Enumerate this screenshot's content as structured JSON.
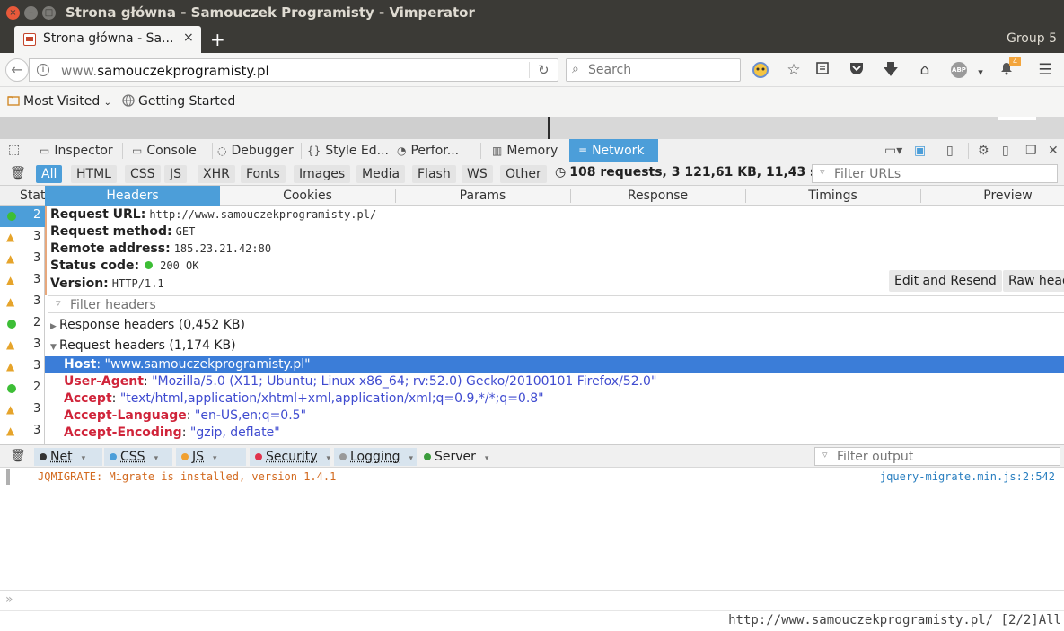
{
  "window": {
    "title": "Strona główna - Samouczek Programisty - Vimperator",
    "close_glyph": "×",
    "min_glyph": "–",
    "max_glyph": "□"
  },
  "tabs": {
    "active_label": "Strona główna - Sa...",
    "close_glyph": "×",
    "new_tab_glyph": "+",
    "group_label": "Group 5"
  },
  "navbar": {
    "url_host_prefix": "www.",
    "url_host_rest": "samouczekprogramisty.pl",
    "search_placeholder": "Search",
    "badge_count": "4",
    "icons": [
      "back-arrow-icon",
      "info-icon",
      "reload-icon",
      "search-icon",
      "screenshot-icon",
      "bookmark-star-icon",
      "reading-list-icon",
      "pocket-icon",
      "download-icon",
      "home-icon",
      "adblock-icon",
      "notifications-icon",
      "menu-icon"
    ]
  },
  "bookmarks": {
    "most_visited": "Most Visited",
    "getting_started": "Getting Started"
  },
  "devtools": {
    "tabs": [
      {
        "label": "Inspector"
      },
      {
        "label": "Console"
      },
      {
        "label": "Debugger"
      },
      {
        "label": "Style Ed..."
      },
      {
        "label": "Perfor..."
      },
      {
        "label": "Memory"
      },
      {
        "label": "Network"
      }
    ],
    "active_tab": "Network"
  },
  "network": {
    "filters": [
      "All",
      "HTML",
      "CSS",
      "JS",
      "XHR",
      "Fonts",
      "Images",
      "Media",
      "Flash",
      "WS",
      "Other"
    ],
    "active_filter": "All",
    "summary": "108 requests, 3 121,61 KB, 11,43 s",
    "filter_urls_placeholder": "Filter URLs",
    "status_column": "Status",
    "rows": [
      {
        "type": "ok",
        "code": "2"
      },
      {
        "type": "warn",
        "code": "3"
      },
      {
        "type": "warn",
        "code": "3"
      },
      {
        "type": "warn",
        "code": "3"
      },
      {
        "type": "warn",
        "code": "3"
      },
      {
        "type": "ok",
        "code": "2"
      },
      {
        "type": "warn",
        "code": "3"
      },
      {
        "type": "warn",
        "code": "3"
      },
      {
        "type": "ok",
        "code": "2"
      },
      {
        "type": "warn",
        "code": "3"
      },
      {
        "type": "warn",
        "code": "3"
      }
    ]
  },
  "details": {
    "tabs": [
      "Headers",
      "Cookies",
      "Params",
      "Response",
      "Timings",
      "Preview"
    ],
    "active_tab": "Headers",
    "request_url_label": "Request URL:",
    "request_url": "http://www.samouczekprogramisty.pl/",
    "method_label": "Request method:",
    "method": "GET",
    "remote_label": "Remote address:",
    "remote": "185.23.21.42:80",
    "status_label": "Status code:",
    "status": "200 OK",
    "version_label": "Version:",
    "version": "HTTP/1.1",
    "edit_resend": "Edit and Resend",
    "raw_headers": "Raw head",
    "filter_headers_placeholder": "Filter headers",
    "response_headers": "Response headers (0,452 KB)",
    "request_headers": "Request headers (1,174 KB)",
    "headers": [
      {
        "key": "Host",
        "value": "\"www.samouczekprogramisty.pl\""
      },
      {
        "key": "User-Agent",
        "value": "\"Mozilla/5.0 (X11; Ubuntu; Linux x86_64; rv:52.0) Gecko/20100101 Firefox/52.0\""
      },
      {
        "key": "Accept",
        "value": "\"text/html,application/xhtml+xml,application/xml;q=0.9,*/*;q=0.8\""
      },
      {
        "key": "Accept-Language",
        "value": "\"en-US,en;q=0.5\""
      },
      {
        "key": "Accept-Encoding",
        "value": "\"gzip, deflate\""
      }
    ]
  },
  "console": {
    "buttons": [
      {
        "label": "Net",
        "color": "#333333"
      },
      {
        "label": "CSS",
        "color": "#4c9ed9"
      },
      {
        "label": "JS",
        "color": "#f0a030"
      },
      {
        "label": "Security",
        "color": "#e0334d"
      },
      {
        "label": "Logging",
        "color": "#999999"
      },
      {
        "label": "Server",
        "color": "#3b9c3b"
      }
    ],
    "filter_output_placeholder": "Filter output",
    "log_message": "JQMIGRATE: Migrate is installed, version 1.4.1",
    "log_source": "jquery-migrate.min.js:2:542",
    "prompt": "»"
  },
  "statusline": {
    "text": "http://www.samouczekprogramisty.pl/ [2/2]All"
  }
}
